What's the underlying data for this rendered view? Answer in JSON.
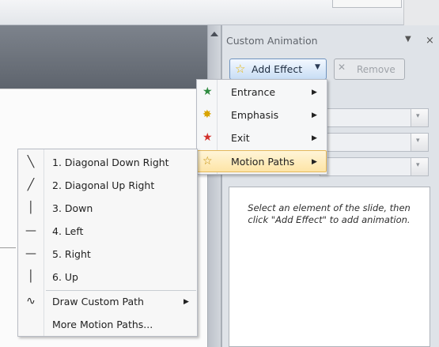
{
  "pane": {
    "title": "Custom Animation",
    "caret": "▼",
    "close": "×",
    "add_effect": {
      "label": "Add Effect",
      "icon": "add-effect-star-icon",
      "caret": "▼"
    },
    "remove": {
      "label": "Remove",
      "icon": "remove-icon"
    },
    "dropdown_caret": "▾",
    "hint": "Select an element of the slide, then click \"Add Effect\" to add animation."
  },
  "effect_menu": {
    "items": [
      {
        "label": "Entrance",
        "icon": "entrance-star-icon",
        "glyph": "★",
        "color": "#2e8a3f",
        "arrow": "▶"
      },
      {
        "label": "Emphasis",
        "icon": "emphasis-star-icon",
        "glyph": "✸",
        "color": "#d9a400",
        "arrow": "▶"
      },
      {
        "label": "Exit",
        "icon": "exit-star-icon",
        "glyph": "★",
        "color": "#d2322c",
        "arrow": "▶"
      },
      {
        "label": "Motion Paths",
        "icon": "motion-paths-star-icon",
        "glyph": "☆",
        "color": "#c18a00",
        "arrow": "▶",
        "highlighted": true
      }
    ]
  },
  "motion_submenu": {
    "items": [
      {
        "label": "1. Diagonal Down Right",
        "icon": "diagonal-down-right-icon",
        "glyph": "╲"
      },
      {
        "label": "2. Diagonal Up Right",
        "icon": "diagonal-up-right-icon",
        "glyph": "╱"
      },
      {
        "label": "3. Down",
        "icon": "down-line-icon",
        "glyph": "│"
      },
      {
        "label": "4. Left",
        "icon": "left-line-icon",
        "glyph": "—"
      },
      {
        "label": "5. Right",
        "icon": "right-line-icon",
        "glyph": "—"
      },
      {
        "label": "6. Up",
        "icon": "up-line-icon",
        "glyph": "│"
      },
      {
        "label": "Draw Custom Path",
        "icon": "draw-custom-path-icon",
        "glyph": "∿",
        "arrow": "▶"
      },
      {
        "label": "More Motion Paths...",
        "icon": "",
        "glyph": ""
      }
    ]
  }
}
